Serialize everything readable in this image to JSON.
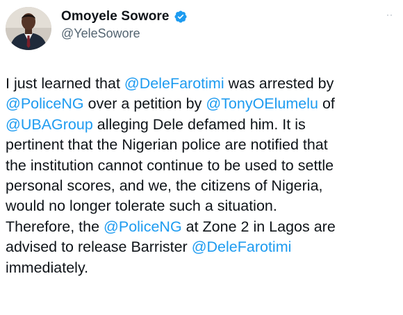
{
  "author": {
    "display_name": "Omoyele Sowore",
    "handle": "@YeleSowore",
    "verified": true
  },
  "menu_label": "··",
  "tweet_lines": [
    [
      {
        "t": "I just learned that ",
        "m": false
      },
      {
        "t": "@DeleFarotimi",
        "m": true
      },
      {
        "t": " was arrested by",
        "m": false
      }
    ],
    [
      {
        "t": "@PoliceNG",
        "m": true
      },
      {
        "t": " over a petition by ",
        "m": false
      },
      {
        "t": "@TonyOElumelu",
        "m": true
      },
      {
        "t": " of",
        "m": false
      }
    ],
    [
      {
        "t": "@UBAGroup",
        "m": true
      },
      {
        "t": " alleging Dele defamed him. It is",
        "m": false
      }
    ],
    [
      {
        "t": "pertinent that the Nigerian police are notified that",
        "m": false
      }
    ],
    [
      {
        "t": "the institution cannot continue to be used to settle",
        "m": false
      }
    ],
    [
      {
        "t": "personal scores, and we, the citizens of Nigeria,",
        "m": false
      }
    ],
    [
      {
        "t": "would no longer tolerate such a situation.",
        "m": false
      }
    ],
    [
      {
        "t": "Therefore, the ",
        "m": false
      },
      {
        "t": "@PoliceNG",
        "m": true
      },
      {
        "t": " at Zone 2 in Lagos are",
        "m": false
      }
    ],
    [
      {
        "t": "advised to release Barrister ",
        "m": false
      },
      {
        "t": "@DeleFarotimi",
        "m": true
      }
    ],
    [
      {
        "t": "immediately.",
        "m": false
      }
    ]
  ],
  "colors": {
    "mention": "#1d9bf0",
    "text": "#0f1419",
    "secondary": "#536471",
    "verified": "#1d9bf0"
  }
}
